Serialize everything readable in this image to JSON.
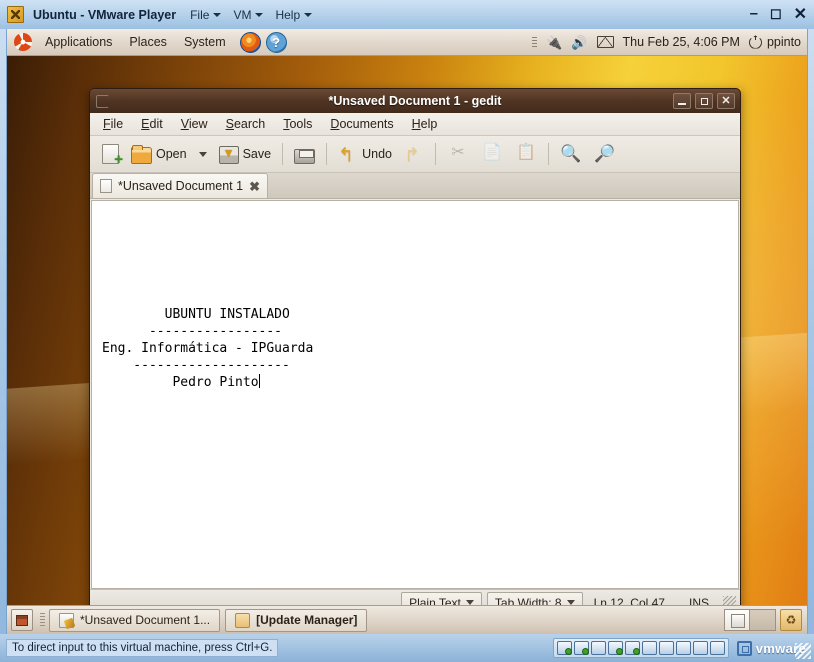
{
  "vmware": {
    "title": "Ubuntu - VMware Player",
    "icon": "vmware-app-icon",
    "menus": [
      {
        "label": "File",
        "icon": "chevron-down-icon"
      },
      {
        "label": "VM",
        "icon": "chevron-down-icon"
      },
      {
        "label": "Help",
        "icon": "chevron-down-icon"
      }
    ],
    "window_buttons": {
      "minimize": "–",
      "maximize": "☐",
      "close": "✕"
    },
    "statusbar": {
      "hint": "To direct input to this virtual machine, press Ctrl+G.",
      "devices": [
        "hard-disk-icon",
        "cd-dvd-icon",
        "floppy-icon",
        "network-icon",
        "sound-icon",
        "display-icon",
        "printer-icon",
        "usb-icon",
        "usb-icon",
        "disconnect-icon"
      ],
      "brand": "vmware"
    }
  },
  "gnome_top_panel": {
    "logo": "ubuntu-logo-icon",
    "menus": [
      "Applications",
      "Places",
      "System"
    ],
    "launchers": [
      {
        "name": "firefox-icon",
        "glyph": ""
      },
      {
        "name": "help-icon",
        "glyph": "?"
      }
    ],
    "tray": [
      "grip-handle",
      "power-plug-icon",
      "volume-icon",
      "envelope-icon"
    ],
    "clock": "Thu Feb 25,  4:06 PM",
    "user": "ppinto",
    "power_icon": "power-icon"
  },
  "gedit": {
    "title": "*Unsaved Document 1 - gedit",
    "window_buttons": {
      "minimize": "–",
      "maximize": "□",
      "close": "✕"
    },
    "menubar": [
      {
        "mnemonic": "F",
        "rest": "ile"
      },
      {
        "mnemonic": "E",
        "rest": "dit"
      },
      {
        "mnemonic": "V",
        "rest": "iew"
      },
      {
        "mnemonic": "S",
        "rest": "earch"
      },
      {
        "mnemonic": "T",
        "rest": "ools"
      },
      {
        "mnemonic": "D",
        "rest": "ocuments"
      },
      {
        "mnemonic": "H",
        "rest": "elp"
      }
    ],
    "toolbar": [
      {
        "name": "new-button",
        "icon": "new-document-icon",
        "label": "",
        "disabled": false
      },
      {
        "name": "open-button",
        "icon": "open-folder-icon",
        "label": "Open",
        "disabled": false
      },
      {
        "name": "open-dropdown",
        "icon": "chevron-down-icon",
        "label": "",
        "disabled": false
      },
      {
        "name": "save-button",
        "icon": "save-disk-icon",
        "label": "Save",
        "disabled": false
      },
      {
        "name": "print-button",
        "icon": "printer-icon",
        "label": "",
        "disabled": false
      },
      {
        "name": "undo-button",
        "icon": "undo-arrow-icon",
        "label": "Undo",
        "disabled": false
      },
      {
        "name": "redo-button",
        "icon": "redo-arrow-icon",
        "label": "",
        "disabled": true
      },
      {
        "name": "cut-button",
        "icon": "scissors-icon",
        "label": "",
        "disabled": true
      },
      {
        "name": "copy-button",
        "icon": "copy-icon",
        "label": "",
        "disabled": true
      },
      {
        "name": "paste-button",
        "icon": "clipboard-icon",
        "label": "",
        "disabled": true
      },
      {
        "name": "find-button",
        "icon": "magnifier-icon",
        "label": "",
        "disabled": false
      },
      {
        "name": "replace-button",
        "icon": "find-replace-icon",
        "label": "",
        "disabled": false
      }
    ],
    "tab": {
      "label": "*Unsaved Document 1",
      "icon": "document-icon",
      "close_glyph": "✖"
    },
    "document": {
      "lines": [
        "        UBUNTU INSTALADO",
        "      -----------------",
        "Eng. Informática - IPGuarda",
        "    --------------------",
        "         Pedro Pinto"
      ]
    },
    "statusbar": {
      "language": "Plain Text",
      "tab_width": "Tab Width: 8",
      "position": "Ln 12, Col 47",
      "insert_mode": "INS"
    }
  },
  "gnome_bottom_panel": {
    "show_desktop": "show-desktop-icon",
    "tasks": [
      {
        "label": "*Unsaved Document 1...",
        "icon": "gedit-icon",
        "active": true
      },
      {
        "label": "[Update Manager]",
        "icon": "update-manager-icon",
        "active": false
      }
    ],
    "workspaces": [
      {
        "index": 1,
        "active": true
      },
      {
        "index": 2,
        "active": false
      }
    ],
    "trash": "trash-icon"
  }
}
